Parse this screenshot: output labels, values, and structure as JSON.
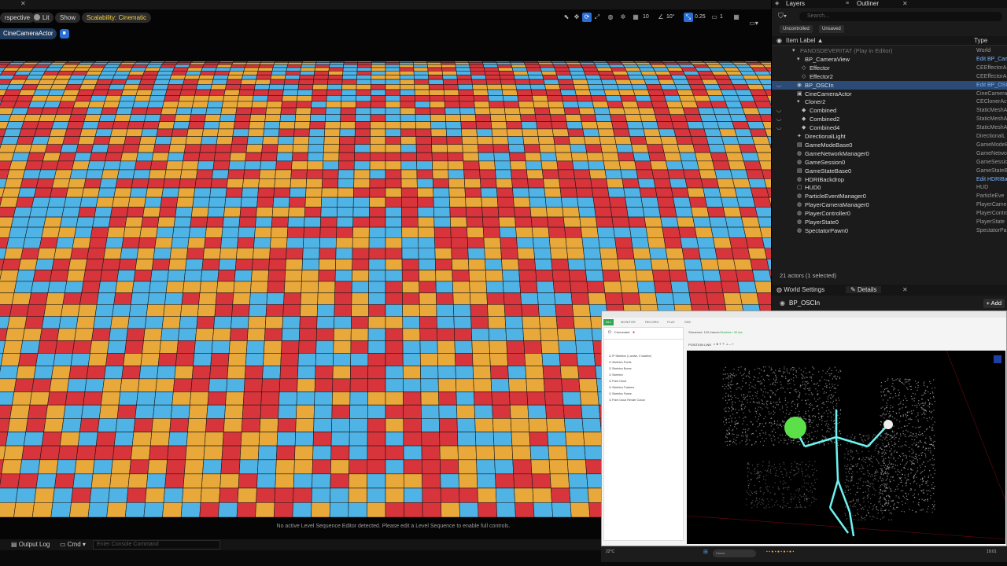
{
  "viewport": {
    "toolbar": {
      "perspective_label": "rspective",
      "lit_label": "Lit",
      "show_label": "Show",
      "scalability_label": "Scalability: Cinematic",
      "grid_value": "10",
      "angle_value": "10°",
      "scale_value": "0.25",
      "camera_speed": "1"
    },
    "camera_actor_label": "CineCameraActor",
    "sequence_message": "No active Level Sequence Editor detected. Please edit a Level Sequence to enable full controls.",
    "tile_colors": [
      "#d8343b",
      "#4fb3e6",
      "#e9a83a"
    ]
  },
  "bottom_bar": {
    "output_log_label": "Output Log",
    "cmd_label": "Cmd",
    "console_placeholder": "Enter Console Command"
  },
  "right_panel": {
    "tabs": {
      "layers": "Layers",
      "outliner": "Outliner"
    },
    "search_placeholder": "Search...",
    "filter_buttons": {
      "uncontrolled": "Uncontrolled",
      "unsaved": "Unsaved"
    },
    "columns": {
      "item_label": "Item Label ▲",
      "type": "Type"
    },
    "rows": [
      {
        "label": "PANDSDEVERITAT (Play in Editor)",
        "type": "World",
        "indent": 1,
        "icon": "▾",
        "muted": true
      },
      {
        "label": "BP_CameraView",
        "type": "Edit BP_Cam",
        "indent": 2,
        "icon": "▾",
        "link": true
      },
      {
        "label": "Effector",
        "type": "CEEffectorA",
        "indent": 3,
        "icon": "◇"
      },
      {
        "label": "Effector2",
        "type": "CEEffectorA",
        "indent": 3,
        "icon": "◇"
      },
      {
        "label": "BP_OSCIn",
        "type": "Edit BP_OSC",
        "indent": 2,
        "icon": "◉",
        "link": true,
        "selected": true,
        "eye": true
      },
      {
        "label": "CineCameraActor",
        "type": "CineCameraA",
        "indent": 2,
        "icon": "▣"
      },
      {
        "label": "Cloner2",
        "type": "CEClonerAct",
        "indent": 2,
        "icon": "▾"
      },
      {
        "label": "Combined",
        "type": "StaticMeshA",
        "indent": 3,
        "icon": "◆",
        "eye": true
      },
      {
        "label": "Combined2",
        "type": "StaticMeshA",
        "indent": 3,
        "icon": "◆",
        "eye": true
      },
      {
        "label": "Combined4",
        "type": "StaticMeshA",
        "indent": 3,
        "icon": "◆",
        "eye": true
      },
      {
        "label": "DirectionalLight",
        "type": "DirectionalL",
        "indent": 2,
        "icon": "✦"
      },
      {
        "label": "GameModeBase0",
        "type": "GameModeB",
        "indent": 2,
        "icon": "▤"
      },
      {
        "label": "GameNetworkManager0",
        "type": "GameNetwo",
        "indent": 2,
        "icon": "◍"
      },
      {
        "label": "GameSession0",
        "type": "GameSession",
        "indent": 2,
        "icon": "◍"
      },
      {
        "label": "GameStateBase0",
        "type": "GameStateB",
        "indent": 2,
        "icon": "▤"
      },
      {
        "label": "HDRIBackdrop",
        "type": "Edit HDRIBa",
        "indent": 2,
        "icon": "◍",
        "link": true
      },
      {
        "label": "HUD0",
        "type": "HUD",
        "indent": 2,
        "icon": "▢"
      },
      {
        "label": "ParticleEventManager0",
        "type": "ParticleEve",
        "indent": 2,
        "icon": "◍"
      },
      {
        "label": "PlayerCameraManager0",
        "type": "PlayerCame",
        "indent": 2,
        "icon": "◍"
      },
      {
        "label": "PlayerController0",
        "type": "PlayerContro",
        "indent": 2,
        "icon": "◍"
      },
      {
        "label": "PlayerState0",
        "type": "PlayerState",
        "indent": 2,
        "icon": "◍"
      },
      {
        "label": "SpectatorPawn0",
        "type": "SpectatorPa",
        "indent": 2,
        "icon": "◍"
      }
    ],
    "actor_count": "21 actors (1 selected)",
    "detail_tabs": {
      "world_settings": "World Settings",
      "details": "Details"
    },
    "selected_actor": "BP_OSCIn",
    "add_label": "+ Add"
  },
  "tracking_app": {
    "tabs": [
      {
        "label": "ALL",
        "active": true
      },
      {
        "label": "MONITOR"
      },
      {
        "label": "RECORD"
      },
      {
        "label": "PLAY"
      },
      {
        "label": "SDK"
      }
    ],
    "connect_label": "Connected",
    "list_items": [
      "IP Skeleton (1 active, 0 inactive)",
      "Skeleton Points",
      "Skeleton Bones",
      "Skeleton",
      "Point Cloud",
      "Skeleton Trackers",
      "Skeleton Frame",
      "Point Cloud Render Colour"
    ],
    "info_a": "Streamed: 120 frames",
    "info_b": "Skeleton: 30 fps",
    "toolbar_label": "POSITION LINE"
  },
  "taskbar": {
    "weather": "22°C",
    "search_placeholder": "Cerca",
    "clock": "19:01"
  }
}
